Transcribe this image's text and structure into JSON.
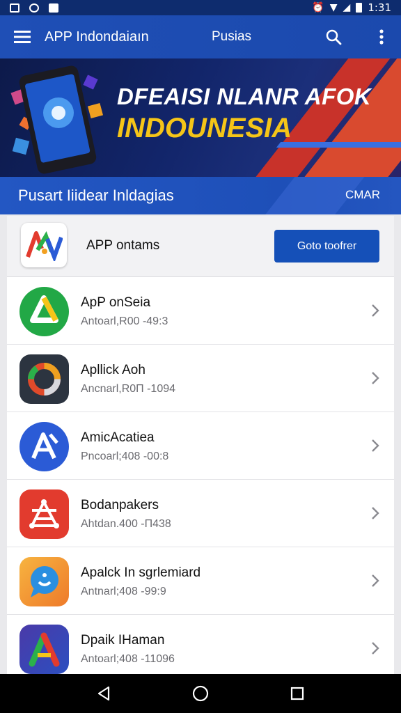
{
  "status_bar": {
    "time": "1:31"
  },
  "app_bar": {
    "title": "APP Indondaiaın",
    "subtitle": "Pusias"
  },
  "banner": {
    "headline": "DFEAISI NLANR AFOK",
    "subheadline": "INDOUNESIA"
  },
  "section": {
    "title": "Pusart Iiidear Inldagias",
    "action": "CMAR"
  },
  "featured": {
    "name": "APP ontams",
    "button_label": "Goto toofrer"
  },
  "apps": [
    {
      "name": "ApP onSeia",
      "meta": "Antoarl,R00 -49:3",
      "icon": "green-drive-icon",
      "color": "#22a846"
    },
    {
      "name": "Apllick Aoh",
      "meta": "Ancnarl,R0П -1094",
      "icon": "ring-camera-icon",
      "color": "#2c3440"
    },
    {
      "name": "AmicAcatiea",
      "meta": "Pncoarl;408 -00:8",
      "icon": "blue-a-icon",
      "color": "#2b5bd6"
    },
    {
      "name": "Bodanpakers",
      "meta": "Ahtdan.400 -П438",
      "icon": "red-network-icon",
      "color": "#e23b2e"
    },
    {
      "name": "Apalck In sgrlemiard",
      "meta": "Antnarl;408 -99:9",
      "icon": "chat-bubble-icon",
      "color": "#f2a33a"
    },
    {
      "name": "Dpaik IHaman",
      "meta": "Antoarl;408 -11096",
      "icon": "triangle-a-icon",
      "color": "#3b56b8"
    }
  ]
}
